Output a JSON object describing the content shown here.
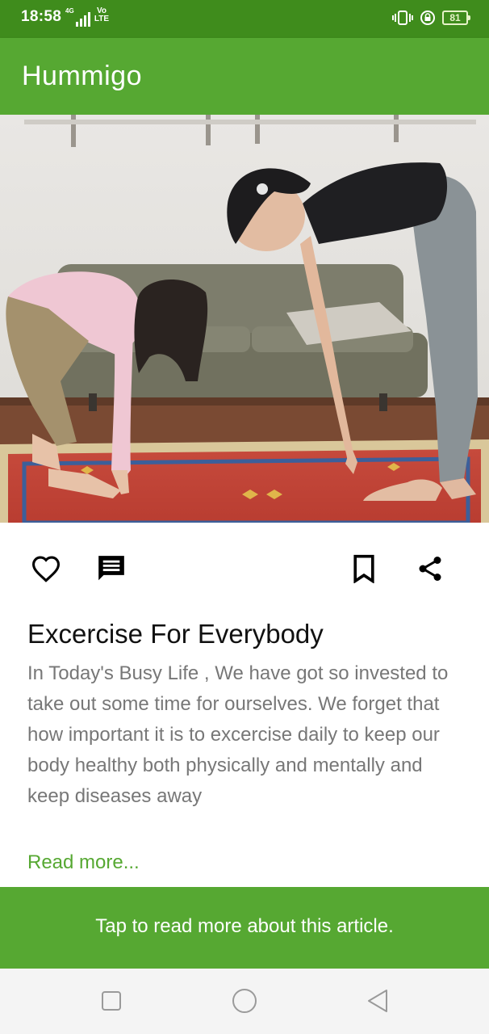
{
  "status_bar": {
    "time": "18:58",
    "network": "4G",
    "volte": "Vo LTE",
    "battery": "81",
    "icons": [
      "vibrate-icon",
      "lock-rotation-icon",
      "battery-icon"
    ]
  },
  "app_bar": {
    "title": "Hummigo"
  },
  "hero": {
    "alt": "Woman and girl stretching together on a red rug"
  },
  "actions": {
    "like_icon": "heart-outline-icon",
    "comment_icon": "comment-icon",
    "bookmark_icon": "bookmark-outline-icon",
    "share_icon": "share-icon"
  },
  "article": {
    "title": "Excercise For Everybody",
    "body": "In Today's Busy Life , We have got so invested to take out some time for ourselves. We forget that how important it is to excercise daily to keep our body healthy both physically and mentally and keep diseases away",
    "read_more": "Read more..."
  },
  "cta": {
    "text": "Tap to read more about this article."
  },
  "nav_bar": {
    "icons": [
      "recents-square-icon",
      "home-circle-icon",
      "back-triangle-icon"
    ]
  },
  "colors": {
    "status_bar": "#3f8c1c",
    "primary": "#56a832",
    "nav_bar": "#f4f4f4"
  }
}
